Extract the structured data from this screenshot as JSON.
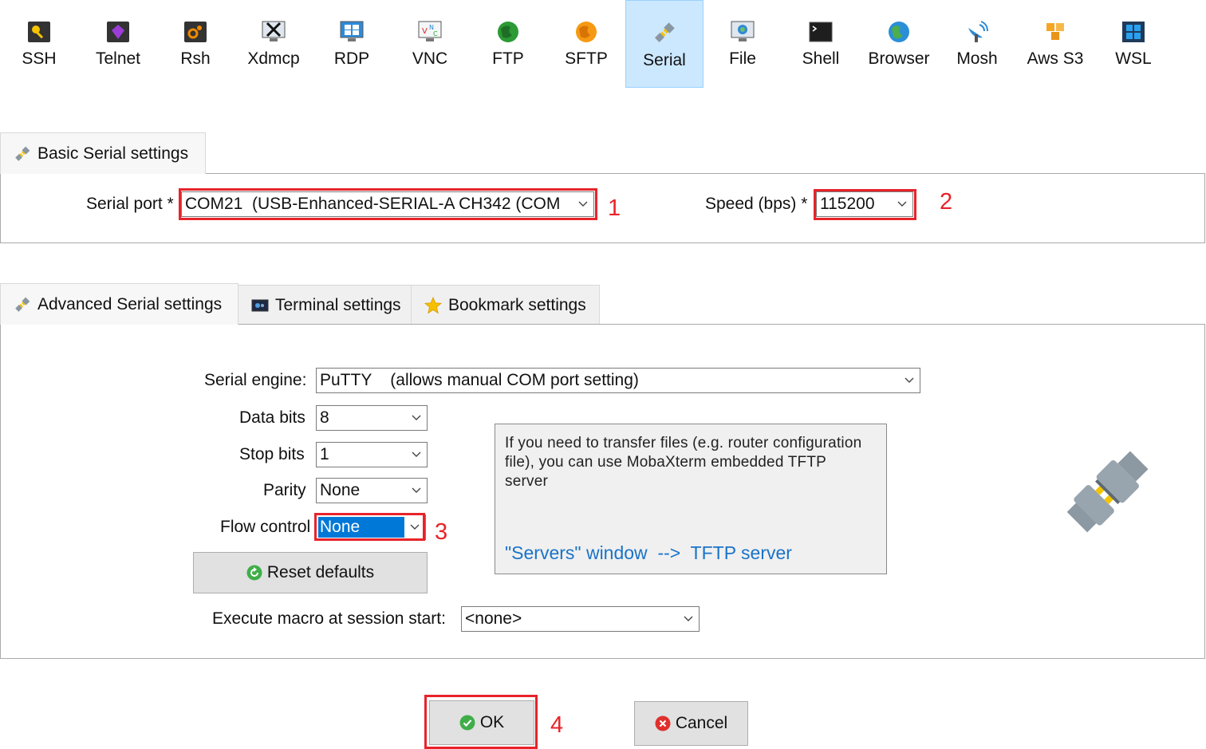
{
  "sessions": [
    {
      "label": "SSH",
      "icon": "key-icon"
    },
    {
      "label": "Telnet",
      "icon": "telnet-gem-icon"
    },
    {
      "label": "Rsh",
      "icon": "rsh-gear-icon"
    },
    {
      "label": "Xdmcp",
      "icon": "x-monitor-icon"
    },
    {
      "label": "RDP",
      "icon": "rdp-monitor-icon"
    },
    {
      "label": "VNC",
      "icon": "vnc-monitor-icon"
    },
    {
      "label": "FTP",
      "icon": "ftp-globe-icon"
    },
    {
      "label": "SFTP",
      "icon": "sftp-globe-icon"
    },
    {
      "label": "Serial",
      "icon": "serial-plug-icon",
      "selected": true
    },
    {
      "label": "File",
      "icon": "file-monitor-icon"
    },
    {
      "label": "Shell",
      "icon": "terminal-icon"
    },
    {
      "label": "Browser",
      "icon": "browser-globe-icon"
    },
    {
      "label": "Mosh",
      "icon": "satellite-icon"
    },
    {
      "label": "Aws S3",
      "icon": "aws-cubes-icon"
    },
    {
      "label": "WSL",
      "icon": "windows-icon"
    }
  ],
  "basic": {
    "tab_label": "Basic Serial settings",
    "serial_port_label": "Serial port *",
    "serial_port_value": "COM21  (USB-Enhanced-SERIAL-A CH342 (COM",
    "speed_label": "Speed (bps) *",
    "speed_value": "115200"
  },
  "advanced_tabs": [
    {
      "label": "Advanced Serial settings",
      "icon": "serial-plug-icon",
      "active": true
    },
    {
      "label": "Terminal settings",
      "icon": "terminal-settings-icon"
    },
    {
      "label": "Bookmark settings",
      "icon": "star-icon"
    }
  ],
  "advanced": {
    "engine_label": "Serial engine:",
    "engine_value": "PuTTY    (allows manual COM port setting)",
    "data_bits_label": "Data bits",
    "data_bits_value": "8",
    "stop_bits_label": "Stop bits",
    "stop_bits_value": "1",
    "parity_label": "Parity",
    "parity_value": "None",
    "flow_label": "Flow control",
    "flow_value": "None",
    "reset_label": "Reset defaults",
    "macro_label": "Execute macro at session start:",
    "macro_value": "<none>",
    "info_text": "If you need to transfer files (e.g. router configuration file), you can use MobaXterm embedded TFTP server",
    "info_link": "\"Servers\" window  -->  TFTP server"
  },
  "annotations": [
    "1",
    "2",
    "3",
    "4"
  ],
  "buttons": {
    "ok_label": "OK",
    "cancel_label": "Cancel"
  },
  "colors": {
    "accent_selected": "#cce8ff",
    "annotation_red": "#e8232a",
    "link_blue": "#1a73c8",
    "selection_blue": "#0078d7"
  }
}
